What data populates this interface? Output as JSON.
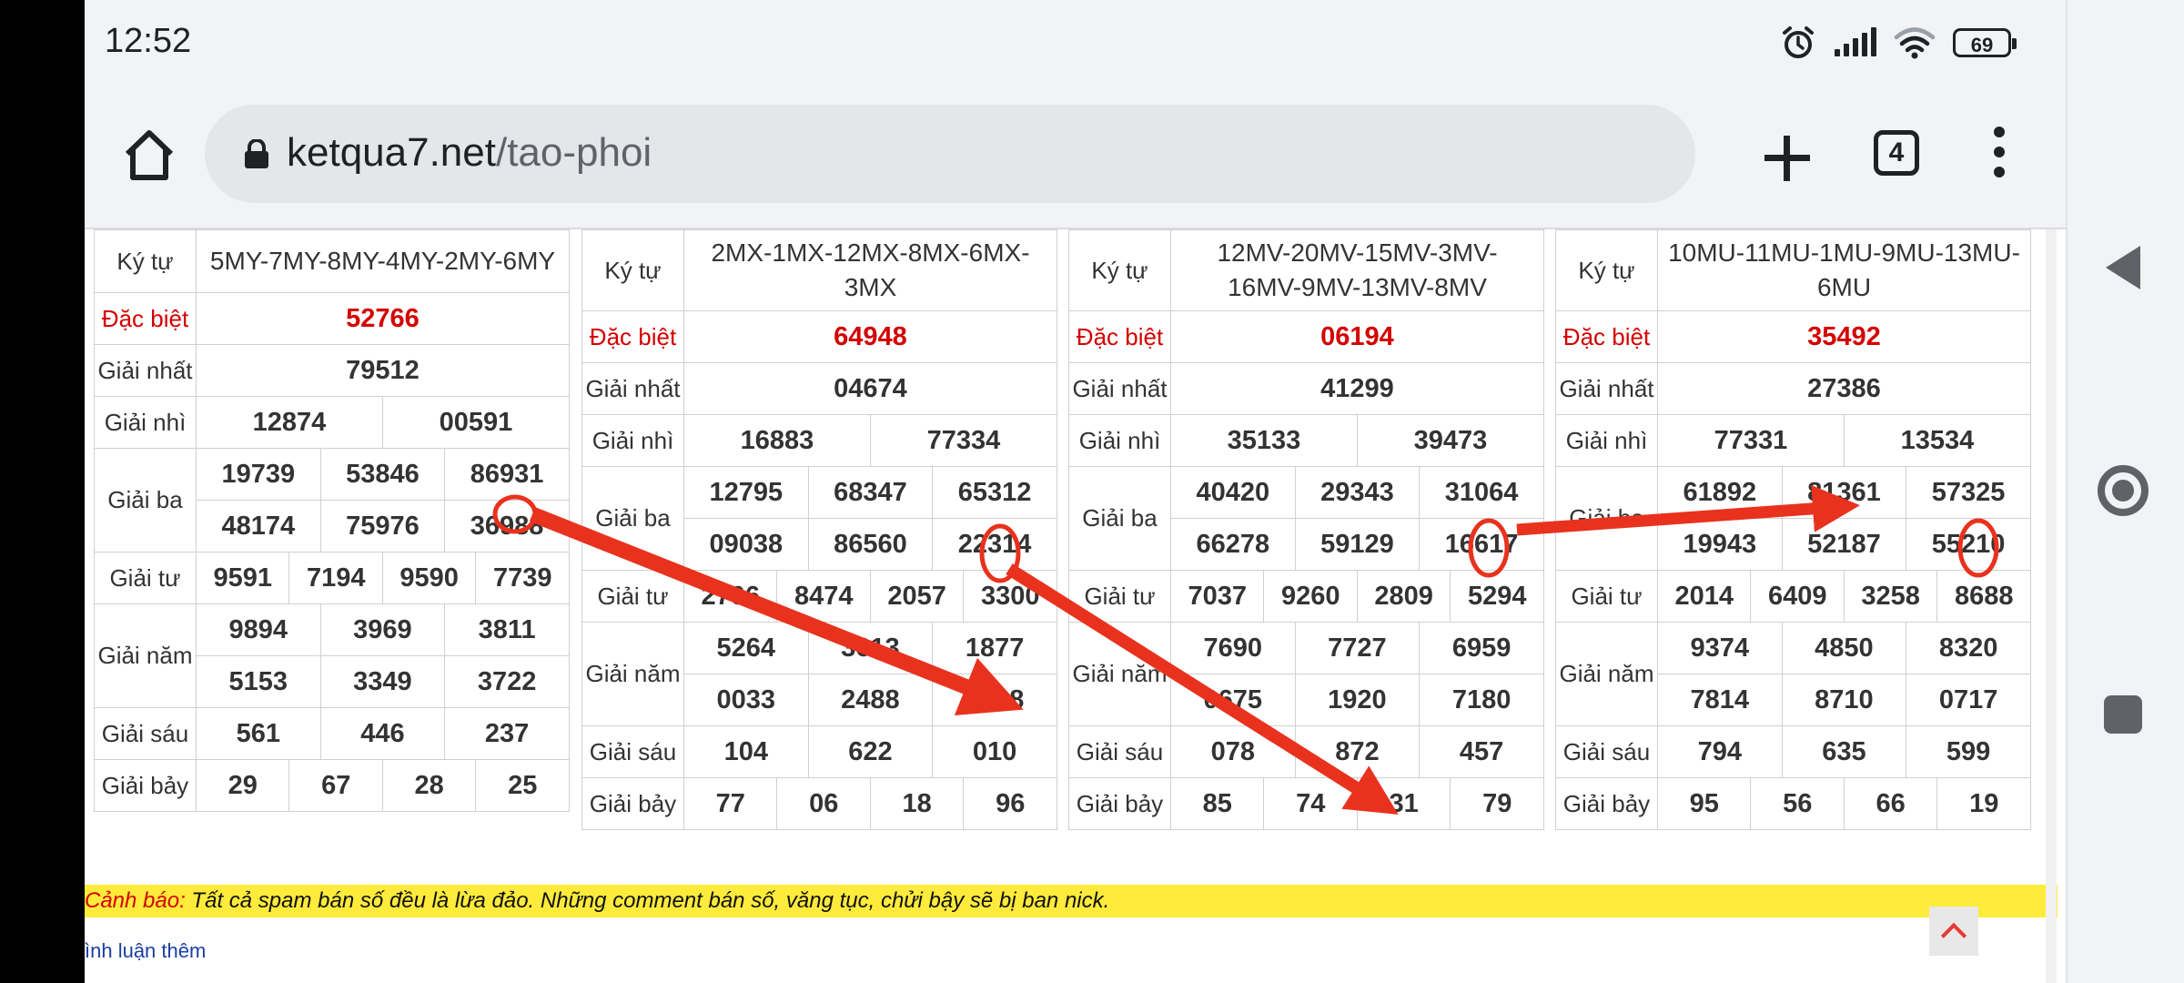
{
  "status_bar": {
    "time": "12:52",
    "battery": "69"
  },
  "browser": {
    "url_domain": "ketqua7.net",
    "url_path": "/tao-phoi",
    "tab_count": "4"
  },
  "cards": [
    {
      "ky_tu_label": "Ký tự",
      "ky_tu": "5MY-7MY-8MY-4MY-2MY-6MY",
      "rows": [
        {
          "label": "Đặc biệt",
          "values": [
            "52766"
          ]
        },
        {
          "label": "Giải nhất",
          "values": [
            "79512"
          ]
        },
        {
          "label": "Giải nhì",
          "values": [
            "12874",
            "00591"
          ]
        },
        {
          "label": "Giải ba",
          "values": [
            "19739",
            "53846",
            "86931",
            "48174",
            "75976",
            "36988"
          ]
        },
        {
          "label": "Giải tư",
          "values": [
            "9591",
            "7194",
            "9590",
            "7739"
          ]
        },
        {
          "label": "Giải năm",
          "values": [
            "9894",
            "3969",
            "3811",
            "5153",
            "3349",
            "3722"
          ]
        },
        {
          "label": "Giải sáu",
          "values": [
            "561",
            "446",
            "237"
          ]
        },
        {
          "label": "Giải bảy",
          "values": [
            "29",
            "67",
            "28",
            "25"
          ]
        }
      ]
    },
    {
      "ky_tu_label": "Ký tự",
      "ky_tu": "2MX-1MX-12MX-8MX-6MX-3MX",
      "rows": [
        {
          "label": "Đặc biệt",
          "values": [
            "64948"
          ]
        },
        {
          "label": "Giải nhất",
          "values": [
            "04674"
          ]
        },
        {
          "label": "Giải nhì",
          "values": [
            "16883",
            "77334"
          ]
        },
        {
          "label": "Giải ba",
          "values": [
            "12795",
            "68347",
            "65312",
            "09038",
            "86560",
            "22314"
          ]
        },
        {
          "label": "Giải tư",
          "values": [
            "2706",
            "8474",
            "2057",
            "3300"
          ]
        },
        {
          "label": "Giải năm",
          "values": [
            "5264",
            "3613",
            "1877",
            "0033",
            "2488",
            "6198"
          ]
        },
        {
          "label": "Giải sáu",
          "values": [
            "104",
            "622",
            "010"
          ]
        },
        {
          "label": "Giải bảy",
          "values": [
            "77",
            "06",
            "18",
            "96"
          ]
        }
      ]
    },
    {
      "ky_tu_label": "Ký tự",
      "ky_tu": "12MV-20MV-15MV-3MV-16MV-9MV-13MV-8MV",
      "rows": [
        {
          "label": "Đặc biệt",
          "values": [
            "06194"
          ]
        },
        {
          "label": "Giải nhất",
          "values": [
            "41299"
          ]
        },
        {
          "label": "Giải nhì",
          "values": [
            "35133",
            "39473"
          ]
        },
        {
          "label": "Giải ba",
          "values": [
            "40420",
            "29343",
            "31064",
            "66278",
            "59129",
            "16617"
          ]
        },
        {
          "label": "Giải tư",
          "values": [
            "7037",
            "9260",
            "2809",
            "5294"
          ]
        },
        {
          "label": "Giải năm",
          "values": [
            "7690",
            "7727",
            "6959",
            "0675",
            "1920",
            "7180"
          ]
        },
        {
          "label": "Giải sáu",
          "values": [
            "078",
            "872",
            "457"
          ]
        },
        {
          "label": "Giải bảy",
          "values": [
            "85",
            "74",
            "31",
            "79"
          ]
        }
      ]
    },
    {
      "ky_tu_label": "Ký tự",
      "ky_tu": "10MU-11MU-1MU-9MU-13MU-6MU",
      "rows": [
        {
          "label": "Đặc biệt",
          "values": [
            "35492"
          ]
        },
        {
          "label": "Giải nhất",
          "values": [
            "27386"
          ]
        },
        {
          "label": "Giải nhì",
          "values": [
            "77331",
            "13534"
          ]
        },
        {
          "label": "Giải ba",
          "values": [
            "61892",
            "81361",
            "57325",
            "19943",
            "52187",
            "55210"
          ]
        },
        {
          "label": "Giải tư",
          "values": [
            "2014",
            "6409",
            "3258",
            "8688"
          ]
        },
        {
          "label": "Giải năm",
          "values": [
            "9374",
            "4850",
            "8320",
            "7814",
            "8710",
            "0717"
          ]
        },
        {
          "label": "Giải sáu",
          "values": [
            "794",
            "635",
            "599"
          ]
        },
        {
          "label": "Giải bảy",
          "values": [
            "95",
            "56",
            "66",
            "19"
          ]
        }
      ]
    }
  ],
  "warning": {
    "label": "Cảnh báo:",
    "text": " Tất cả spam bán số đều là lừa đảo. Những comment bán số, văng tục, chửi bậy sẽ bị ban nick."
  },
  "more_comments": "ình luận thêm",
  "colors": {
    "prize_red": "#d40000",
    "arrow_red": "#e8321e",
    "warning_yellow": "#ffeb3b"
  }
}
